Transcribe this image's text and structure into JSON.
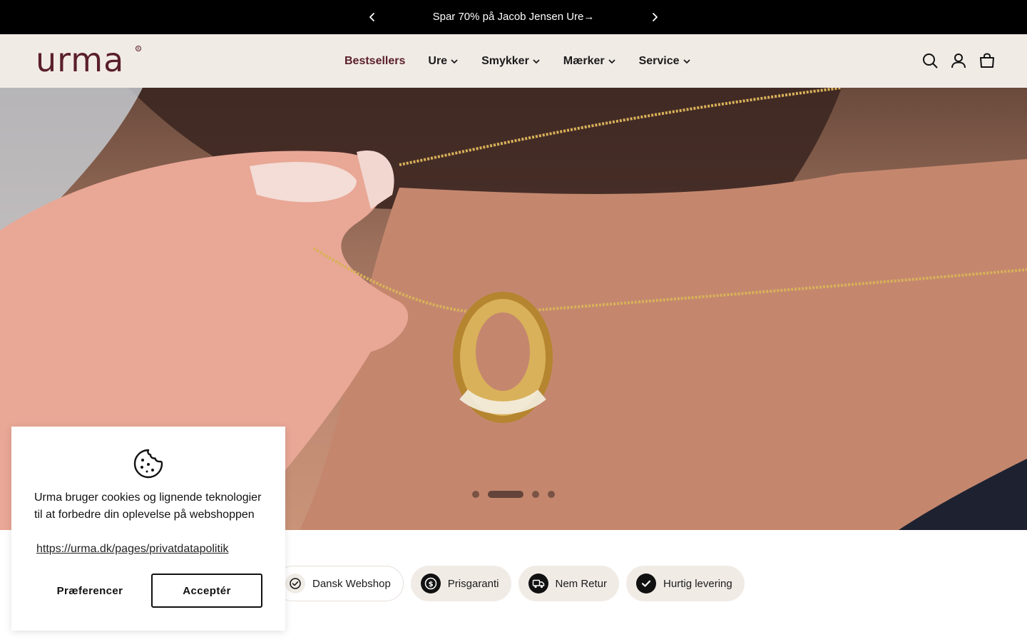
{
  "announcement": {
    "message": "Spar 70% på Jacob Jensen Ure→"
  },
  "header": {
    "logo_text": "urma",
    "brand_color": "#5a1f2b",
    "nav": [
      {
        "label": "Bestsellers",
        "has_dropdown": false,
        "active": true
      },
      {
        "label": "Ure",
        "has_dropdown": true
      },
      {
        "label": "Smykker",
        "has_dropdown": true
      },
      {
        "label": "Mærker",
        "has_dropdown": true
      },
      {
        "label": "Service",
        "has_dropdown": true
      }
    ],
    "icons": [
      "search-icon",
      "account-icon",
      "cart-icon"
    ]
  },
  "hero": {
    "slide_count": 4,
    "active_slide": 2
  },
  "usps": [
    {
      "label": "Dansk Webshop",
      "icon": "check-badge-icon"
    },
    {
      "label": "Prisgaranti",
      "icon": "dollar-coin-icon"
    },
    {
      "label": "Nem Retur",
      "icon": "truck-icon"
    },
    {
      "label": "Hurtig levering",
      "icon": "checkmark-icon"
    }
  ],
  "cookie": {
    "icon": "cookie-icon",
    "text": "Urma bruger cookies og lignende teknologier til at forbedre din oplevelse på webshoppen",
    "link": "https://urma.dk/pages/privatdatapolitik",
    "preferences_label": "Præferencer",
    "accept_label": "Acceptér"
  }
}
